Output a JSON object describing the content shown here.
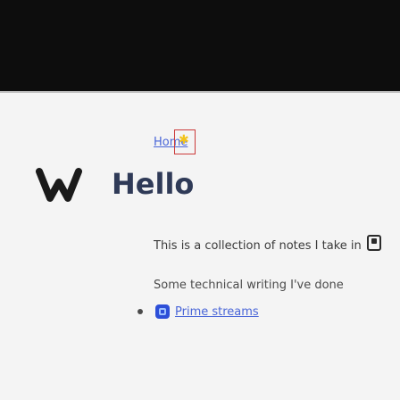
{
  "nav": {
    "home_label": "Home",
    "star_icon": "star-icon"
  },
  "main": {
    "title": "Hello",
    "intro_text": "This is a collection of notes I take in ",
    "intro_icon": "notes-app-icon",
    "subtitle": "Some technical writing I've done",
    "links": [
      {
        "label": "Prime streams",
        "icon": "stream-icon"
      }
    ]
  },
  "colors": {
    "header": "#0d0d0d",
    "link": "#4a66d8",
    "title": "#2f3a57",
    "accent_star": "#f2c31b",
    "nav_box_border": "#cc3b3b"
  }
}
